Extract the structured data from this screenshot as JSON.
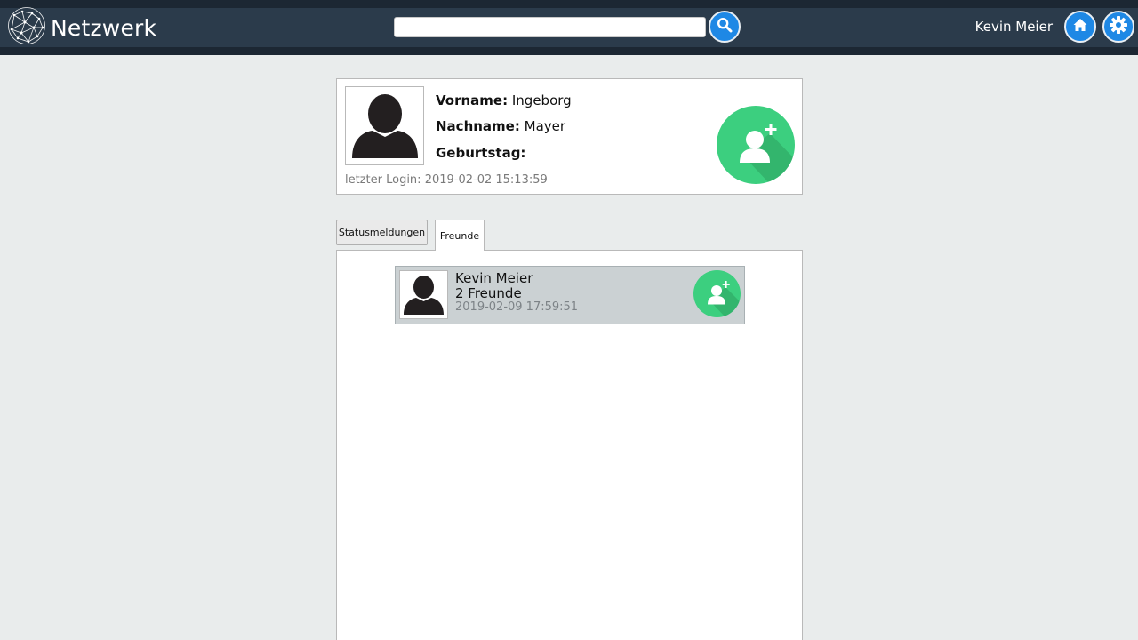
{
  "header": {
    "logo_text": "Netzwerk",
    "search": {
      "value": "",
      "placeholder": ""
    },
    "user_name": "Kevin Meier",
    "icons": {
      "search": "search-icon",
      "home": "home-icon",
      "settings": "gear-icon",
      "logo": "network-globe-icon"
    },
    "colors": {
      "bar": "#2b3b4b",
      "button": "#1e88e5"
    }
  },
  "profile": {
    "first_name_label": "Vorname:",
    "first_name": "Ingeborg",
    "last_name_label": "Nachname:",
    "last_name": "Mayer",
    "birthday_label": "Geburtstag:",
    "birthday": "",
    "last_login_label": "letzter Login:",
    "last_login": "2019-02-02 15:13:59",
    "add_friend_icon": "add-user-icon",
    "accent": "#3ccf7f"
  },
  "tabs": [
    {
      "label": "Statusmeldungen",
      "active": false
    },
    {
      "label": "Freunde",
      "active": true
    }
  ],
  "friends": [
    {
      "name": "Kevin Meier",
      "friend_count": "2 Freunde",
      "timestamp": "2019-02-09 17:59:51"
    }
  ]
}
